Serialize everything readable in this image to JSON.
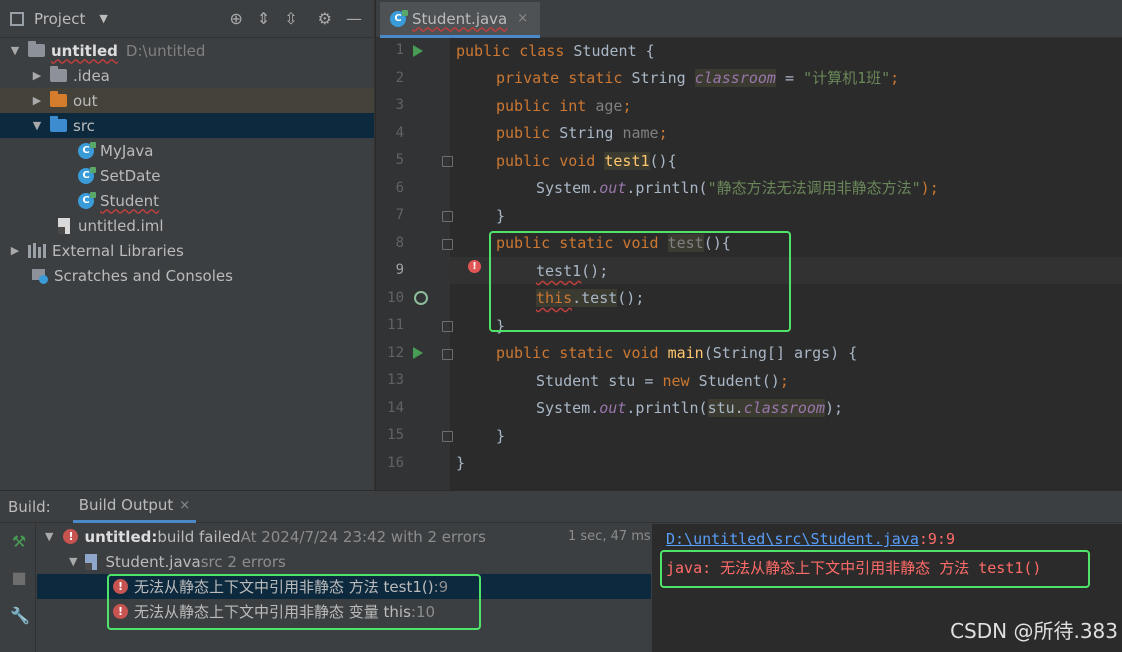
{
  "project_panel": {
    "title": "Project",
    "tree": {
      "root_name": "untitled",
      "root_path": "D:\\untitled",
      "idea": ".idea",
      "out": "out",
      "src": "src",
      "classes": [
        "MyJava",
        "SetDate",
        "Student"
      ],
      "iml": "untitled.iml",
      "external_libraries": "External Libraries",
      "scratches": "Scratches and Consoles"
    }
  },
  "editor": {
    "tab_title": "Student.java",
    "tab_close": "×",
    "line_numbers": [
      "1",
      "2",
      "3",
      "4",
      "5",
      "6",
      "7",
      "8",
      "9",
      "10",
      "11",
      "12",
      "13",
      "14",
      "15",
      "16"
    ],
    "code": {
      "l1_kw": "public class ",
      "l1_name": "Student {",
      "l2_kw": "private static ",
      "l2_type": "String ",
      "l2_field": "classroom",
      "l2_eq": " = ",
      "l2_str": "\"计算机1班\"",
      "l2_end": ";",
      "l3_kw": "public int ",
      "l3_field": "age",
      "l3_end": ";",
      "l4_kw": "public ",
      "l4_type": "String ",
      "l4_field": "name",
      "l4_end": ";",
      "l5_kw": "public void ",
      "l5_fn": "test1",
      "l5_end": "(){",
      "l6_a": "System.",
      "l6_out": "out",
      "l6_b": ".println(",
      "l6_str": "\"静态方法无法调用非静态方法\"",
      "l6_end": ");",
      "l7": "}",
      "l8_kw": "public static void ",
      "l8_fn": "test",
      "l8_end": "(){",
      "l9_call": "test1",
      "l9_end": "();",
      "l10_kw": "this",
      "l10_b": ".test",
      "l10_end": "();",
      "l11": "}",
      "l12_kw": "public static void ",
      "l12_fn": "main",
      "l12_end": "(String[] args) {",
      "l13_a": "Student stu = ",
      "l13_kw": "new ",
      "l13_b": "Student()",
      "l13_end": ";",
      "l14_a": "System.",
      "l14_out": "out",
      "l14_b": ".println(",
      "l14_c": "stu.",
      "l14_field": "classroom",
      "l14_end": ");",
      "l15": "}",
      "l16": "}"
    }
  },
  "build": {
    "label": "Build:",
    "tab": "Build Output",
    "tab_close": "×",
    "summary_name": "untitled:",
    "summary_status": " build failed",
    "summary_detail": " At 2024/7/24 23:42 with 2 errors",
    "summary_time": "1 sec, 47 ms",
    "file_name": "Student.java",
    "file_detail": " src 2 errors",
    "errors": [
      {
        "msg": "无法从静态上下文中引用非静态 方法 test1()",
        "loc": " :9"
      },
      {
        "msg": "无法从静态上下文中引用非静态 变量 this",
        "loc": " :10"
      }
    ],
    "console_path": "D:\\untitled\\src\\Student.java",
    "console_loc": ":9:9",
    "console_error": "java: 无法从静态上下文中引用非静态 方法 test1()"
  },
  "watermark": "CSDN @所待.383",
  "colors": {
    "accent": "#4a88c7",
    "callout": "#4fe36a",
    "error": "#c75450",
    "keyword": "#cc7832",
    "string": "#6a8759",
    "function": "#ffc66d",
    "field": "#9876aa"
  }
}
